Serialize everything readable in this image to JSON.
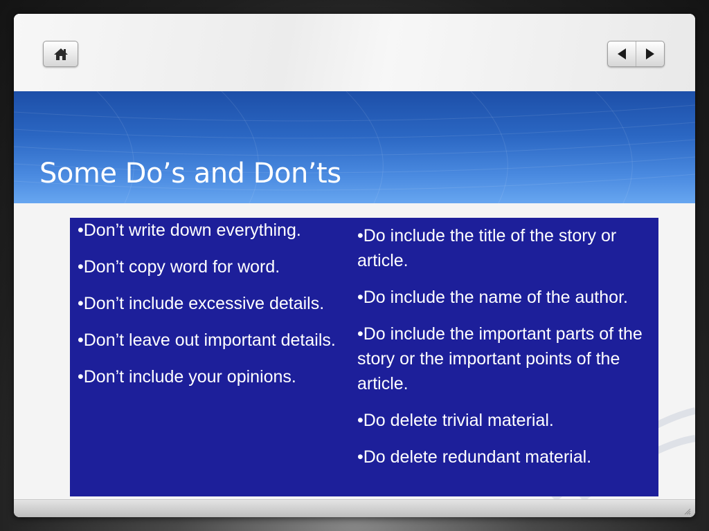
{
  "slide": {
    "title": "Some Do’s and Don’ts",
    "donts": [
      "•Don’t write down everything.",
      "•Don’t copy word for word.",
      "•Don’t include excessive details.",
      "•Don’t leave out important details.",
      "•Don’t include your opinions."
    ],
    "dos": [
      "•Do include the title of the story or article.",
      "•Do include the name of the author.",
      "•Do include the important parts of the story or the important points of the article.",
      "•Do delete trivial material.",
      "•Do delete redundant material."
    ]
  },
  "icons": {
    "home": "home-icon",
    "previous": "arrow-left-icon",
    "next": "arrow-right-icon",
    "resize": "resize-grip-icon"
  },
  "colors": {
    "content_box": "#1d1f9a",
    "title_band_top": "#1d4fa8",
    "title_band_bottom": "#67a6f0",
    "text": "#ffffff"
  }
}
